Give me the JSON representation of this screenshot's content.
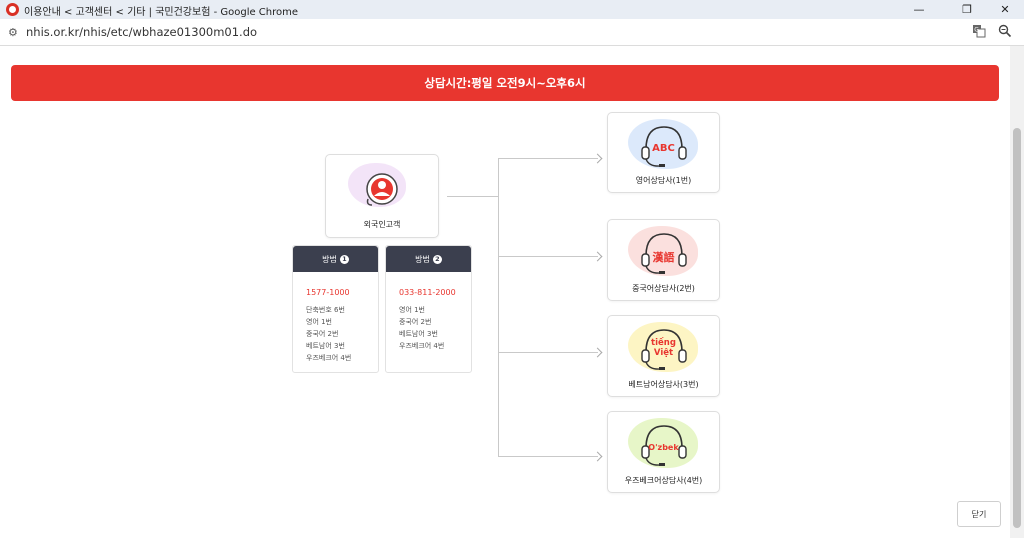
{
  "window": {
    "title": "이용안내 < 고객센터 < 기타 | 국민건강보험 - Google Chrome",
    "url": "nhis.or.kr/nhis/etc/wbhaze01300m01.do",
    "minimize_glyph": "—",
    "restore_glyph": "❐",
    "close_glyph": "✕"
  },
  "banner": {
    "text": "상담시간:평일 오전9시~오후6시"
  },
  "customer": {
    "label": "외국인고객"
  },
  "methods": [
    {
      "label": "방법",
      "number": "1",
      "phone": "1577-1000",
      "options": [
        "단축번호 6번",
        "영어 1번",
        "중국어 2번",
        "베트남어 3번",
        "우즈베크어 4번"
      ]
    },
    {
      "label": "방법",
      "number": "2",
      "phone": "033-811-2000",
      "options": [
        "영어 1번",
        "중국어 2번",
        "베트남어 3번",
        "우즈베크어 4번"
      ]
    }
  ],
  "counselors": [
    {
      "label": "영어상담사(1번)",
      "badge": "ABC",
      "badge_color": "#e8362f",
      "blob_color": "#dce9fb"
    },
    {
      "label": "중국어상담사(2번)",
      "badge": "漢語",
      "badge_color": "#e8362f",
      "blob_color": "#fbe0de"
    },
    {
      "label": "베트남어상담사(3번)",
      "badge": "tiếng Việt",
      "badge_line1": "tiếng",
      "badge_line2": "Việt",
      "badge_color": "#e8362f",
      "blob_color": "#fdf5c4"
    },
    {
      "label": "우즈베크어상담사(4번)",
      "badge": "O'zbek",
      "badge_color": "#e8362f",
      "blob_color": "#e7f6c8"
    }
  ],
  "close_button": {
    "label": "닫기"
  },
  "colors": {
    "accent": "#e8362f",
    "method_header": "#3b3f4e"
  }
}
